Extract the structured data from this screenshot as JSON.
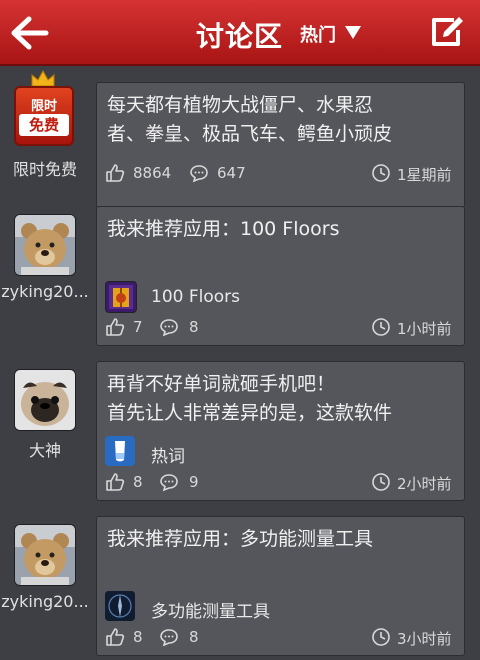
{
  "header": {
    "title": "讨论区",
    "sort_label": "热门"
  },
  "posts": [
    {
      "username": "限时免费",
      "badge_line1": "限时",
      "badge_line2": "免费",
      "text_line1": "每天都有植物大战僵尸、水果忍",
      "text_line2": "者、拳皇、极品飞车、鳄鱼小顽皮",
      "likes": "8864",
      "comments": "647",
      "time": "1星期前"
    },
    {
      "username": "zyking20...",
      "text_line1": "我来推荐应用：100 Floors",
      "app_name": "100 Floors",
      "likes": "7",
      "comments": "8",
      "time": "1小时前"
    },
    {
      "username": "大神",
      "text_line1": "再背不好单词就砸手机吧！",
      "text_line2": "首先让人非常差异的是，这款软件",
      "app_name": "热词",
      "likes": "8",
      "comments": "9",
      "time": "2小时前"
    },
    {
      "username": "zyking20...",
      "text_line1": "我来推荐应用：多功能测量工具",
      "app_name": "多功能测量工具",
      "likes": "8",
      "comments": "8",
      "time": "3小时前"
    }
  ],
  "colors": {
    "header_red": "#c42020",
    "background": "#3e3f44",
    "card": "#55565b"
  }
}
